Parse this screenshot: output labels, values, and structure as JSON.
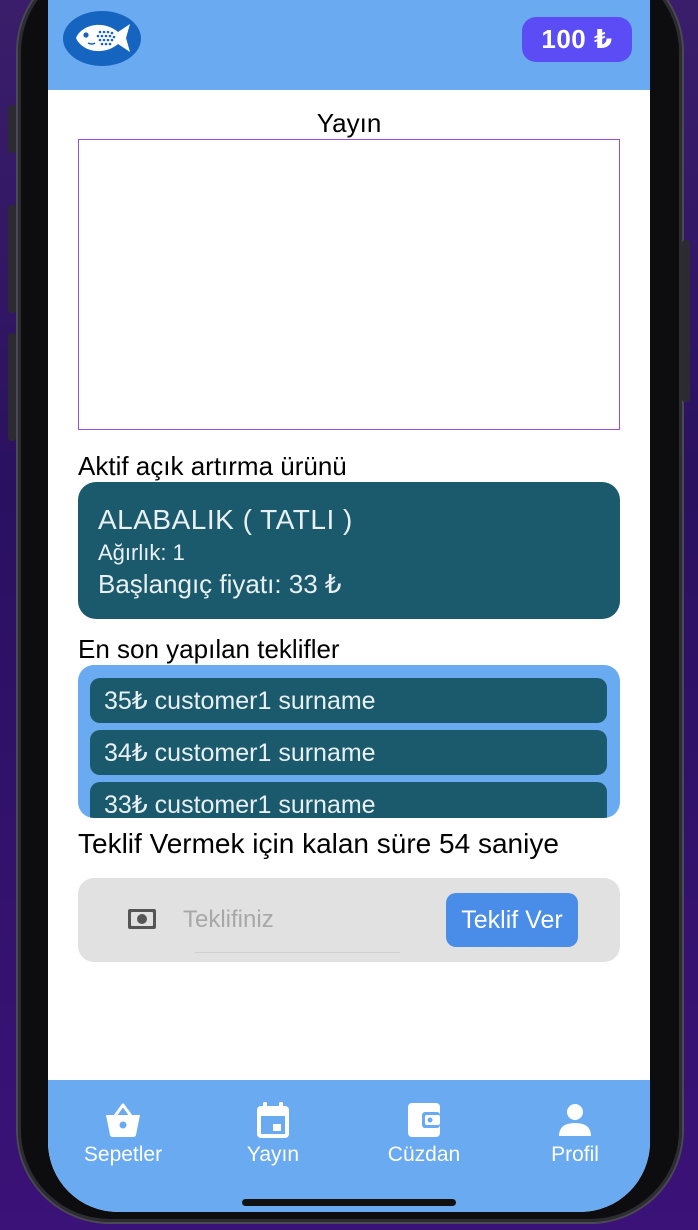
{
  "header": {
    "balance": "100 ₺",
    "logo_icon": "fish-logo-icon"
  },
  "stream": {
    "title": "Yayın"
  },
  "active_product": {
    "section_title": "Aktif açık artırma ürünü",
    "name": "ALABALIK ( TATLI )",
    "weight": "Ağırlık: 1",
    "start_price": "Başlangıç fiyatı: 33 ₺"
  },
  "recent_bids": {
    "section_title": "En son yapılan teklifler",
    "items": [
      {
        "text": "35₺ customer1 surname"
      },
      {
        "text": "34₺ customer1 surname"
      },
      {
        "text": "33₺ customer1 surname"
      }
    ]
  },
  "timer": {
    "text": "Teklif Vermek için kalan süre 54 saniye"
  },
  "bid_form": {
    "icon": "money-icon",
    "placeholder": "Teklifiniz",
    "value": "",
    "submit_label": "Teklif Ver"
  },
  "nav": {
    "items": [
      {
        "label": "Sepetler",
        "icon": "basket-icon"
      },
      {
        "label": "Yayın",
        "icon": "calendar-icon"
      },
      {
        "label": "Cüzdan",
        "icon": "wallet-icon"
      },
      {
        "label": "Profil",
        "icon": "person-icon"
      }
    ]
  },
  "colors": {
    "header_bg": "#6aaaf0",
    "balance_bg": "#5c4cf5",
    "card_bg": "#1b5a6d",
    "button_bg": "#4a8de8",
    "video_border": "#9a4ee0"
  }
}
